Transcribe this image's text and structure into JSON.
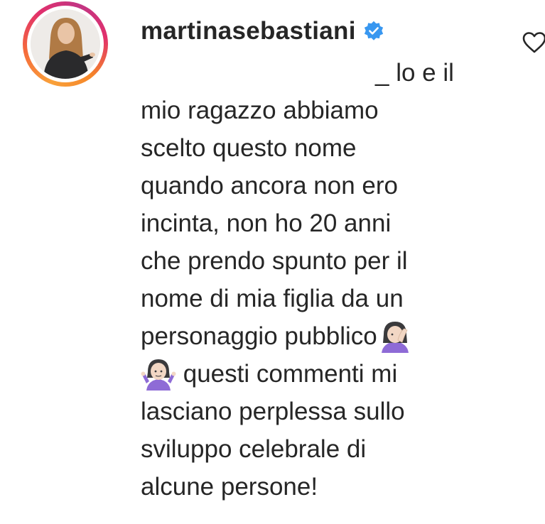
{
  "post": {
    "username": "martinasebastiani",
    "verified": true,
    "comment_lines": [
      "_ lo e il",
      "mio ragazzo abbiamo",
      "scelto questo nome",
      "quando ancora non ero",
      "incinta, non ho 20 anni",
      "che prendo spunto per il",
      "nome di mia figlia da un",
      "personaggio pubblico",
      "questi commenti mi",
      "lasciano perplessa sullo",
      "sviluppo celebrale di",
      "alcune persone!"
    ],
    "emojis": [
      "face-palm-icon",
      "shrug-icon"
    ]
  },
  "icons": {
    "verified": "verified-badge-icon",
    "like": "heart-outline-icon"
  },
  "colors": {
    "text": "#262626",
    "verified_blue": "#3897f0",
    "ring_gradient": [
      "#f9a13a",
      "#e1306c",
      "#c13584"
    ],
    "emoji_purple": "#8e6bd6"
  }
}
